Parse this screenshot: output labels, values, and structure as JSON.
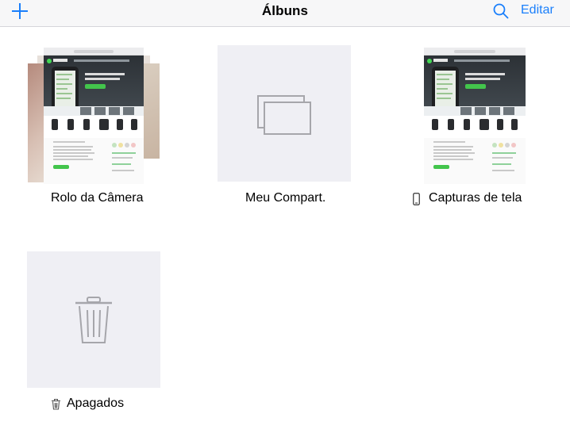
{
  "navbar": {
    "title": "Álbuns",
    "edit_label": "Editar",
    "add_icon": "plus-icon",
    "search_icon": "search-icon",
    "accent_color": "#1a7ffb"
  },
  "albums": [
    {
      "label": "Rolo da Câmera",
      "thumbnail": "screenshot-stack"
    },
    {
      "label": "Meu Compart.",
      "thumbnail": "shared-stack-icon"
    },
    {
      "label": "Capturas de tela",
      "thumbnail": "screenshot",
      "badge_icon": "phone-icon"
    },
    {
      "label": "Apagados",
      "thumbnail": "trash-icon",
      "badge_icon": "trash-icon"
    }
  ]
}
